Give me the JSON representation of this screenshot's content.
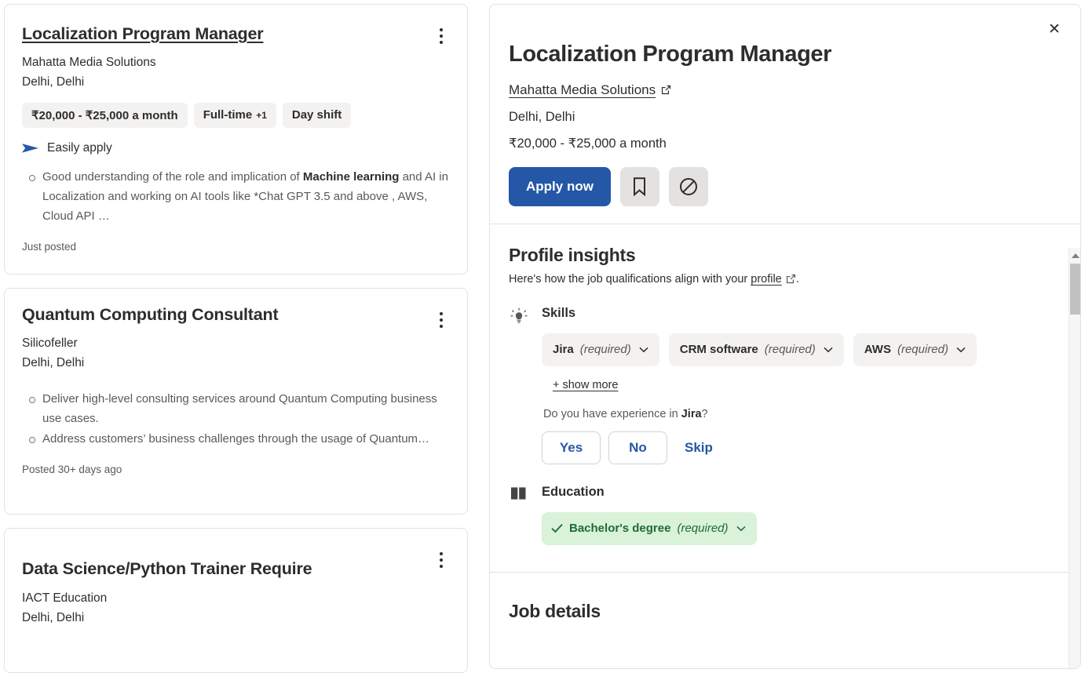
{
  "results": {
    "cards": [
      {
        "title": "Localization Program Manager",
        "company": "Mahatta Media Solutions",
        "location": "Delhi, Delhi",
        "chips": [
          {
            "label": "₹20,000 - ₹25,000 a month",
            "extra": ""
          },
          {
            "label": "Full-time",
            "extra": "+1"
          },
          {
            "label": "Day shift",
            "extra": ""
          }
        ],
        "easily_apply": "Easily apply",
        "snippet_lead": "Good understanding of the role and implication of ",
        "snippet_bold": "Machine learning",
        "snippet_tail": " and AI in Localization and working on AI tools like *Chat GPT 3.5 and above , AWS, Cloud API …",
        "posted": "Just posted"
      },
      {
        "title": "Quantum Computing Consultant",
        "company": "Silicofeller",
        "location": "Delhi, Delhi",
        "bullets": [
          "Deliver high-level consulting services around Quantum Computing business use cases.",
          "Address customers’ business challenges through the usage of Quantum…"
        ],
        "posted": "Posted 30+ days ago"
      },
      {
        "title": "Data Science/Python Trainer Require",
        "company": "IACT Education",
        "location": "Delhi, Delhi"
      }
    ]
  },
  "detail": {
    "close_label": "✕",
    "title": "Localization Program Manager",
    "company": "Mahatta Media Solutions",
    "location": "Delhi, Delhi",
    "salary": "₹20,000 - ₹25,000 a month",
    "apply_label": "Apply now",
    "save_icon_name": "bookmark-icon",
    "hide_icon_name": "block-icon",
    "insights": {
      "title": "Profile insights",
      "subtitle_before": "Here's how the job qualifications align with your ",
      "subtitle_link": "profile",
      "subtitle_after": ".",
      "skills": {
        "label": "Skills",
        "chips": [
          {
            "name": "Jira",
            "req": "(required)"
          },
          {
            "name": "CRM software",
            "req": "(required)"
          },
          {
            "name": "AWS",
            "req": "(required)"
          }
        ],
        "show_more": "+ show more",
        "question_before": "Do you have experience in ",
        "question_skill": "Jira",
        "question_after": "?",
        "answers": [
          "Yes",
          "No"
        ],
        "skip": "Skip"
      },
      "education": {
        "label": "Education",
        "chip": {
          "name": "Bachelor's degree",
          "req": "(required)",
          "matched": true
        }
      }
    },
    "job_details_title": "Job details"
  },
  "colors": {
    "accent_blue": "#2557a7",
    "chip_gray": "#f3f2f1",
    "match_green_bg": "#d9f2d9",
    "match_green_fg": "#1f6b36",
    "border": "#e4e2e0"
  }
}
